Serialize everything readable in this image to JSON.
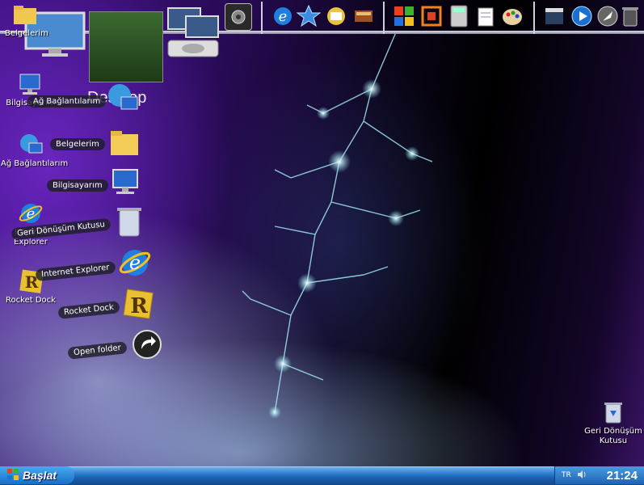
{
  "desktop": {
    "icons": [
      {
        "label": "Belgelerim",
        "icon": "folder-icon"
      },
      {
        "label": "Bilgisayarım",
        "icon": "computer-icon"
      },
      {
        "label": "Ağ Bağlantılarım",
        "icon": "network-icon"
      },
      {
        "label": "Internet Explorer",
        "icon": "ie-icon"
      },
      {
        "label": "Rocket Dock",
        "icon": "rocketdock-icon"
      },
      {
        "label": "Geri Dönüşüm Kutusu",
        "icon": "recycle-bin-icon"
      }
    ],
    "desktop_label": "Desktop"
  },
  "stack": {
    "items": [
      {
        "label": "Ağ Bağlantılarım",
        "icon": "network-icon"
      },
      {
        "label": "Belgelerim",
        "icon": "folder-icon"
      },
      {
        "label": "Bilgisayarım",
        "icon": "computer-icon"
      },
      {
        "label": "Geri Dönüşüm Kutusu",
        "icon": "recycle-bin-icon"
      },
      {
        "label": "Internet Explorer",
        "icon": "ie-icon"
      },
      {
        "label": "Rocket Dock",
        "icon": "rocketdock-icon"
      },
      {
        "label": "Open folder",
        "icon": "open-folder-icon"
      }
    ]
  },
  "dock": {
    "icons": [
      "monitor-icon",
      "settings-icon",
      "ie-icon",
      "star-icon",
      "mail-icon",
      "books-icon",
      "windows-icon",
      "office-icon",
      "calculator-icon",
      "notepad-icon",
      "paint-icon",
      "movie-icon",
      "media-player-icon",
      "rocket-icon",
      "trash-icon"
    ]
  },
  "taskbar": {
    "start_label": "Başlat",
    "language": "TR",
    "clock": "21:24"
  },
  "colors": {
    "taskbar": "#1a5fae",
    "start": "#1670c8",
    "accent": "#6fb0e8"
  }
}
